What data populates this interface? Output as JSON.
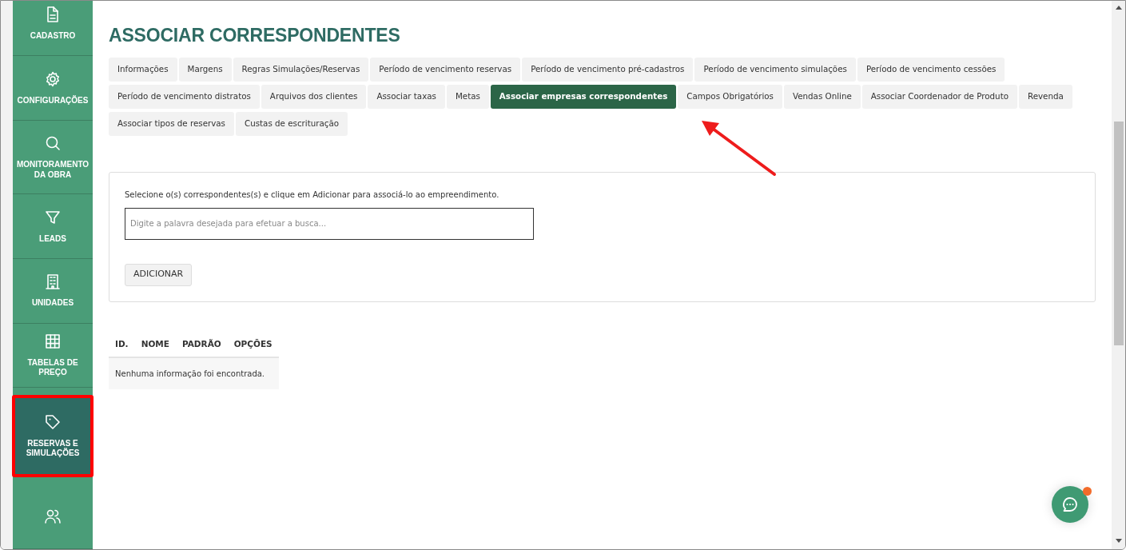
{
  "sidebar": {
    "items": [
      {
        "label": "CADASTRO",
        "selected": false,
        "highlighted": false
      },
      {
        "label": "CONFIGURAÇÕES",
        "selected": false,
        "highlighted": false
      },
      {
        "label": "MONITORAMENTO DA OBRA",
        "selected": false,
        "highlighted": false
      },
      {
        "label": "LEADS",
        "selected": false,
        "highlighted": false
      },
      {
        "label": "UNIDADES",
        "selected": false,
        "highlighted": false
      },
      {
        "label": "TABELAS DE PREÇO",
        "selected": false,
        "highlighted": false
      },
      {
        "label": "RESERVAS E SIMULAÇÕES",
        "selected": true,
        "highlighted": true
      },
      {
        "selected": false,
        "highlighted": false
      }
    ]
  },
  "page": {
    "title": "ASSOCIAR CORRESPONDENTES"
  },
  "tabs": [
    {
      "label": "Informações",
      "selected": false
    },
    {
      "label": "Margens",
      "selected": false
    },
    {
      "label": "Regras Simulações/Reservas",
      "selected": false
    },
    {
      "label": "Período de vencimento reservas",
      "selected": false
    },
    {
      "label": "Período de vencimento pré-cadastros",
      "selected": false
    },
    {
      "label": "Período de vencimento simulações",
      "selected": false
    },
    {
      "label": "Período de vencimento cessões",
      "selected": false
    },
    {
      "label": "Período de vencimento distratos",
      "selected": false
    },
    {
      "label": "Arquivos dos clientes",
      "selected": false
    },
    {
      "label": "Associar taxas",
      "selected": false
    },
    {
      "label": "Metas",
      "selected": false
    },
    {
      "label": "Associar empresas correspondentes",
      "selected": true
    },
    {
      "label": "Campos Obrigatórios",
      "selected": false
    },
    {
      "label": "Vendas Online",
      "selected": false
    },
    {
      "label": "Associar Coordenador de Produto",
      "selected": false
    },
    {
      "label": "Revenda",
      "selected": false
    },
    {
      "label": "Associar tipos de reservas",
      "selected": false
    },
    {
      "label": "Custas de escrituração",
      "selected": false
    }
  ],
  "form": {
    "instruction": "Selecione o(s) correspondentes(s) e clique em Adicionar para associá-lo ao empreendimento.",
    "search": {
      "placeholder": "Digite a palavra desejada para efetuar a busca..."
    },
    "button": "ADICIONAR"
  },
  "table": {
    "columns": [
      "ID.",
      "NOME",
      "PADRÃO",
      "OPÇÕES"
    ],
    "empty_message": "Nenhuma informação foi encontrada."
  },
  "chat": {
    "notification": true
  }
}
